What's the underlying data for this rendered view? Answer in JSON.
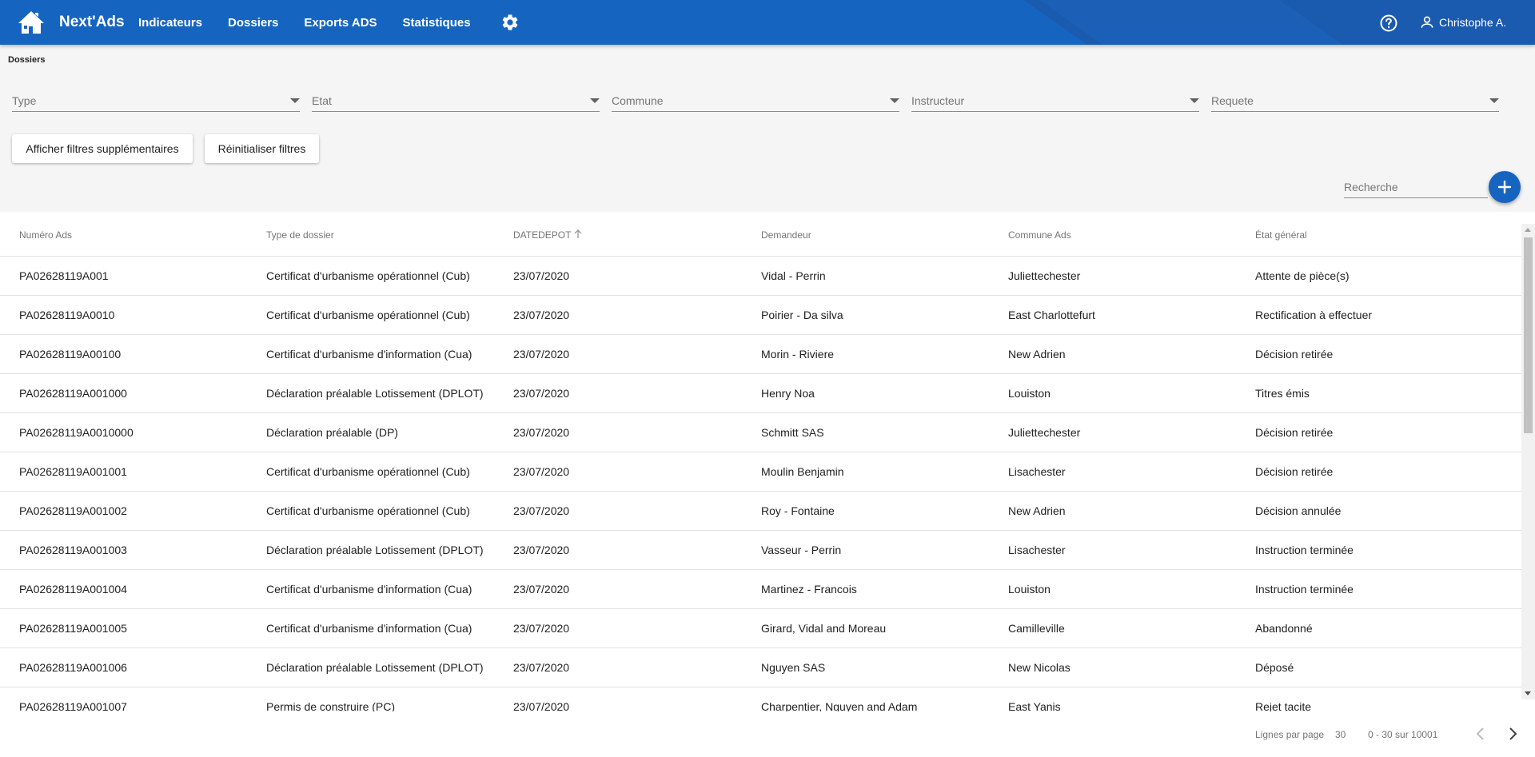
{
  "app": {
    "name": "Next'Ads",
    "nav": [
      "Indicateurs",
      "Dossiers",
      "Exports ADS",
      "Statistiques"
    ],
    "user": "Christophe A."
  },
  "breadcrumb": "Dossiers",
  "filters": [
    "Type",
    "Etat",
    "Commune",
    "Instructeur",
    "Requete"
  ],
  "buttons": {
    "more_filters": "Afficher filtres supplémentaires",
    "reset_filters": "Réinitialiser filtres"
  },
  "search": {
    "placeholder": "Recherche",
    "value": ""
  },
  "table": {
    "columns": [
      "Numéro Ads",
      "Type de dossier",
      "DATEDEPOT",
      "Demandeur",
      "Commune Ads",
      "État général"
    ],
    "sorted_column": "DATEDEPOT",
    "sort_direction": "ascending",
    "rows": [
      [
        "PA02628119A001",
        "Certificat d'urbanisme opérationnel (Cub)",
        "23/07/2020",
        "Vidal - Perrin",
        "Juliettechester",
        "Attente de pièce(s)"
      ],
      [
        "PA02628119A0010",
        "Certificat d'urbanisme opérationnel (Cub)",
        "23/07/2020",
        "Poirier - Da silva",
        "East Charlottefurt",
        "Rectification à effectuer"
      ],
      [
        "PA02628119A00100",
        "Certificat d'urbanisme d'information (Cua)",
        "23/07/2020",
        "Morin - Riviere",
        "New Adrien",
        "Décision retirée"
      ],
      [
        "PA02628119A001000",
        "Déclaration préalable Lotissement (DPLOT)",
        "23/07/2020",
        "Henry Noa",
        "Louiston",
        "Titres émis"
      ],
      [
        "PA02628119A0010000",
        "Déclaration préalable (DP)",
        "23/07/2020",
        "Schmitt SAS",
        "Juliettechester",
        "Décision retirée"
      ],
      [
        "PA02628119A001001",
        "Certificat d'urbanisme opérationnel (Cub)",
        "23/07/2020",
        "Moulin Benjamin",
        "Lisachester",
        "Décision retirée"
      ],
      [
        "PA02628119A001002",
        "Certificat d'urbanisme opérationnel (Cub)",
        "23/07/2020",
        "Roy - Fontaine",
        "New Adrien",
        "Décision annulée"
      ],
      [
        "PA02628119A001003",
        "Déclaration préalable Lotissement (DPLOT)",
        "23/07/2020",
        "Vasseur - Perrin",
        "Lisachester",
        "Instruction terminée"
      ],
      [
        "PA02628119A001004",
        "Certificat d'urbanisme d'information (Cua)",
        "23/07/2020",
        "Martinez - Francois",
        "Louiston",
        "Instruction terminée"
      ],
      [
        "PA02628119A001005",
        "Certificat d'urbanisme d'information (Cua)",
        "23/07/2020",
        "Girard, Vidal and Moreau",
        "Camilleville",
        "Abandonné"
      ],
      [
        "PA02628119A001006",
        "Déclaration préalable Lotissement (DPLOT)",
        "23/07/2020",
        "Nguyen SAS",
        "New Nicolas",
        "Déposé"
      ],
      [
        "PA02628119A001007",
        "Permis de construire (PC)",
        "23/07/2020",
        "Charpentier, Nguyen and Adam",
        "East Yanis",
        "Rejet tacite"
      ]
    ]
  },
  "pagination": {
    "rows_per_page_label": "Lignes par page",
    "rows_per_page": "30",
    "range": "0 - 30 sur 10001"
  },
  "colors": {
    "primary": "#1565c0",
    "background": "#f5f5f5"
  }
}
